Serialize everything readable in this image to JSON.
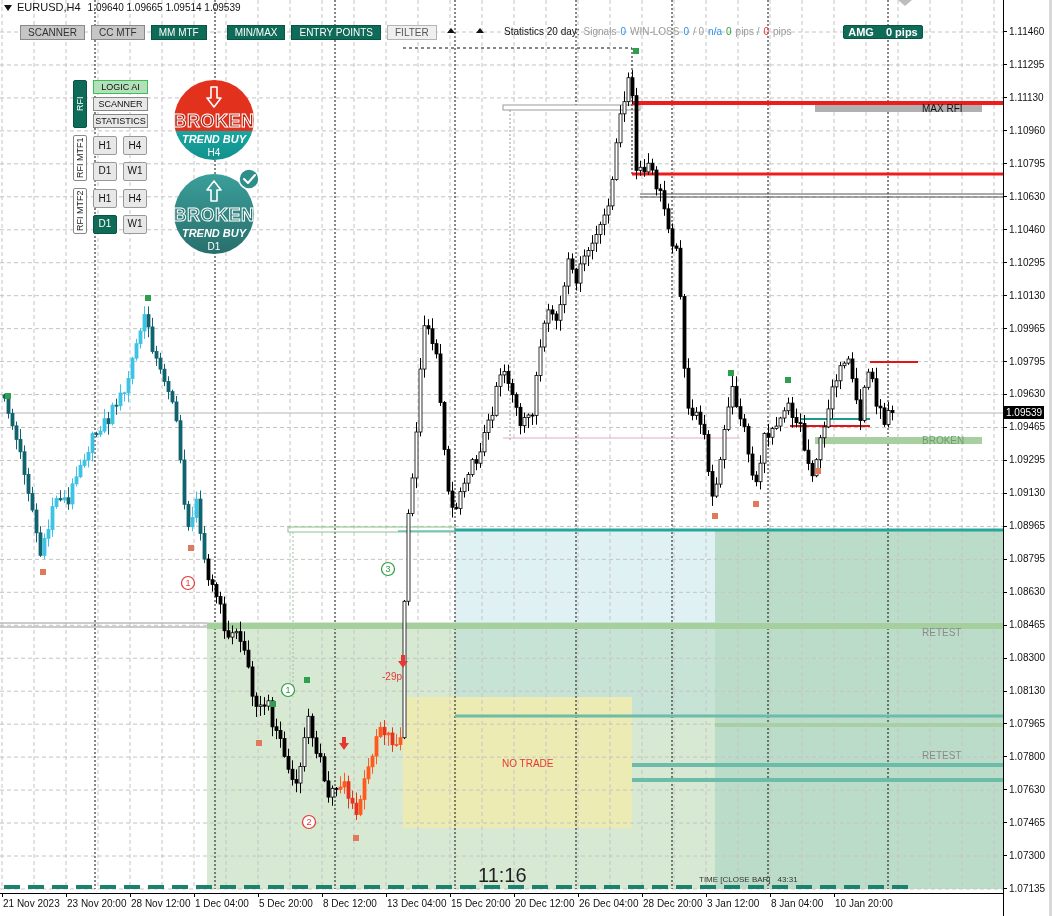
{
  "header": {
    "symbol": "EURUSD,H4",
    "ohlc": "1.09640 1.09665 1.09514 1.09539"
  },
  "toolbar": [
    {
      "label": "SCANNER",
      "on": false,
      "disabled": false
    },
    {
      "label": "CC MTF",
      "on": false,
      "disabled": false
    },
    {
      "label": "MM MTF",
      "on": true,
      "disabled": false
    },
    {
      "label": "MIN/MAX",
      "on": true,
      "disabled": false
    },
    {
      "label": "ENTRY POINTS",
      "on": true,
      "disabled": false
    },
    {
      "label": "FILTER",
      "on": false,
      "disabled": true
    }
  ],
  "statistics": [
    {
      "text": "Statistics 20 day:",
      "kind": "title"
    },
    {
      "text": "Signals",
      "kind": "muted"
    },
    {
      "text": "0",
      "kind": "count"
    },
    {
      "text": "WIN-LOSS",
      "kind": "muted"
    },
    {
      "text": "0",
      "kind": "count"
    },
    {
      "text": "/ 0",
      "kind": "muted"
    },
    {
      "text": "n/a",
      "kind": "count"
    },
    {
      "text": "0",
      "kind": "gain"
    },
    {
      "text": "pips /",
      "kind": "muted"
    },
    {
      "text": "0",
      "kind": "loss"
    },
    {
      "text": "pips",
      "kind": "muted"
    }
  ],
  "amg": {
    "label": "AMG",
    "value": "0 pips"
  },
  "side_panel": [
    {
      "title": "RFI",
      "selected": true,
      "kind": "list",
      "buttons": [
        {
          "label": "LOGIC AI",
          "selected": true
        },
        {
          "label": "SCANNER",
          "selected": false
        },
        {
          "label": "STATISTICS",
          "selected": false
        }
      ]
    },
    {
      "title": "RFI MTF1",
      "selected": false,
      "kind": "grid",
      "buttons": [
        {
          "label": "H1",
          "selected": false
        },
        {
          "label": "H4",
          "selected": false
        },
        {
          "label": "D1",
          "selected": false
        },
        {
          "label": "W1",
          "selected": false
        }
      ]
    },
    {
      "title": "RFI MTF2",
      "selected": false,
      "kind": "grid",
      "buttons": [
        {
          "label": "H1",
          "selected": false
        },
        {
          "label": "H4",
          "selected": false
        },
        {
          "label": "D1",
          "selected": true
        },
        {
          "label": "W1",
          "selected": false
        }
      ]
    }
  ],
  "badges": [
    {
      "title": "BROKEN",
      "subtitle": "TREND BUY",
      "timeframe": "H4",
      "arrow_down": true,
      "checked": false,
      "kind": "split",
      "color": "#e2321e"
    },
    {
      "title": "BROKEN",
      "subtitle": "TREND BUY",
      "timeframe": "D1",
      "arrow_down": false,
      "checked": true,
      "kind": "solid",
      "color": "#3a9f9b"
    }
  ],
  "chart_labels": {
    "max_rfi": "MAX RFI",
    "broken": "BROKEN",
    "retest": [
      "RETEST",
      "RETEST"
    ],
    "no_trade": "NO TRADE",
    "result": "-29p"
  },
  "signals": [
    {
      "number": "1",
      "kind": "sell"
    },
    {
      "number": "1",
      "kind": "buy"
    },
    {
      "number": "2",
      "kind": "sell"
    },
    {
      "number": "3",
      "kind": "buy"
    }
  ],
  "clock": {
    "time": "11:16",
    "timer_label": "TIME [CLOSE BAR]",
    "timer": "43:31"
  },
  "price_axis": {
    "labels": [
      "1.11460",
      "1.11295",
      "1.11130",
      "1.10960",
      "1.10795",
      "1.10630",
      "1.10460",
      "1.10295",
      "1.10130",
      "1.09965",
      "1.09795",
      "1.09630",
      "1.09465",
      "1.09295",
      "1.09130",
      "1.08965",
      "1.08795",
      "1.08630",
      "1.08465",
      "1.08300",
      "1.08130",
      "1.07965",
      "1.07800",
      "1.07630",
      "1.07465",
      "1.07300",
      "1.07135"
    ],
    "current": "1.09539"
  },
  "time_axis": {
    "labels": [
      "21 Nov 2023",
      "23 Nov 20:00",
      "28 Nov 12:00",
      "1 Dec 04:00",
      "5 Dec 20:00",
      "8 Dec 12:00",
      "13 Dec 04:00",
      "15 Dec 20:00",
      "20 Dec 12:00",
      "26 Dec 04:00",
      "28 Dec 20:00",
      "3 Jan 12:00",
      "8 Jan 04:00",
      "10 Jan 20:00"
    ]
  }
}
